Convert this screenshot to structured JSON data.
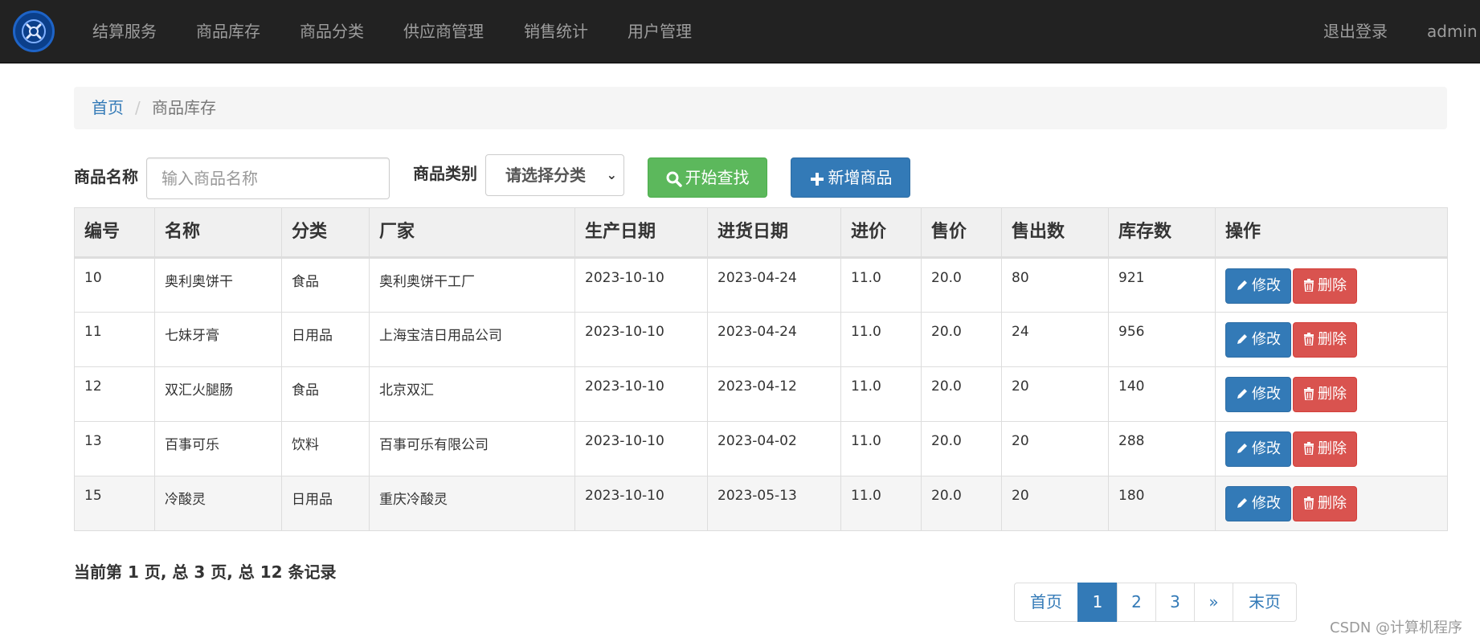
{
  "navbar": {
    "items": [
      {
        "label": "结算服务"
      },
      {
        "label": "商品库存"
      },
      {
        "label": "商品分类"
      },
      {
        "label": "供应商管理"
      },
      {
        "label": "销售统计"
      },
      {
        "label": "用户管理"
      }
    ],
    "logout": "退出登录",
    "user": "admin"
  },
  "breadcrumb": {
    "home": "首页",
    "separator": "/",
    "current": "商品库存"
  },
  "search": {
    "name_label": "商品名称",
    "name_placeholder": "输入商品名称",
    "name_value": "",
    "category_label": "商品类别",
    "category_selected": "请选择分类",
    "search_button": "开始查找",
    "add_button": "新增商品"
  },
  "table": {
    "headers": [
      "编号",
      "名称",
      "分类",
      "厂家",
      "生产日期",
      "进货日期",
      "进价",
      "售价",
      "售出数",
      "库存数",
      "操作"
    ],
    "edit_label": "修改",
    "delete_label": "删除",
    "rows": [
      [
        "10",
        "奥利奥饼干",
        "食品",
        "奥利奥饼干工厂",
        "2023-10-10",
        "2023-04-24",
        "11.0",
        "20.0",
        "80",
        "921"
      ],
      [
        "11",
        "七妹牙膏",
        "日用品",
        "上海宝洁日用品公司",
        "2023-10-10",
        "2023-04-24",
        "11.0",
        "20.0",
        "24",
        "956"
      ],
      [
        "12",
        "双汇火腿肠",
        "食品",
        "北京双汇",
        "2023-10-10",
        "2023-04-12",
        "11.0",
        "20.0",
        "20",
        "140"
      ],
      [
        "13",
        "百事可乐",
        "饮料",
        "百事可乐有限公司",
        "2023-10-10",
        "2023-04-02",
        "11.0",
        "20.0",
        "20",
        "288"
      ],
      [
        "15",
        "冷酸灵",
        "日用品",
        "重庆冷酸灵",
        "2023-10-10",
        "2023-05-13",
        "11.0",
        "20.0",
        "20",
        "180"
      ]
    ]
  },
  "page_info": "当前第 1 页, 总 3 页, 总 12 条记录",
  "pagination": {
    "first": "首页",
    "pages": [
      "1",
      "2",
      "3"
    ],
    "active": "1",
    "next": "»",
    "last": "末页"
  },
  "watermark": "CSDN @计算机程序",
  "colors": {
    "navbar_bg": "#222222",
    "primary": "#337ab7",
    "success": "#5cb85c",
    "danger": "#d9534f"
  }
}
